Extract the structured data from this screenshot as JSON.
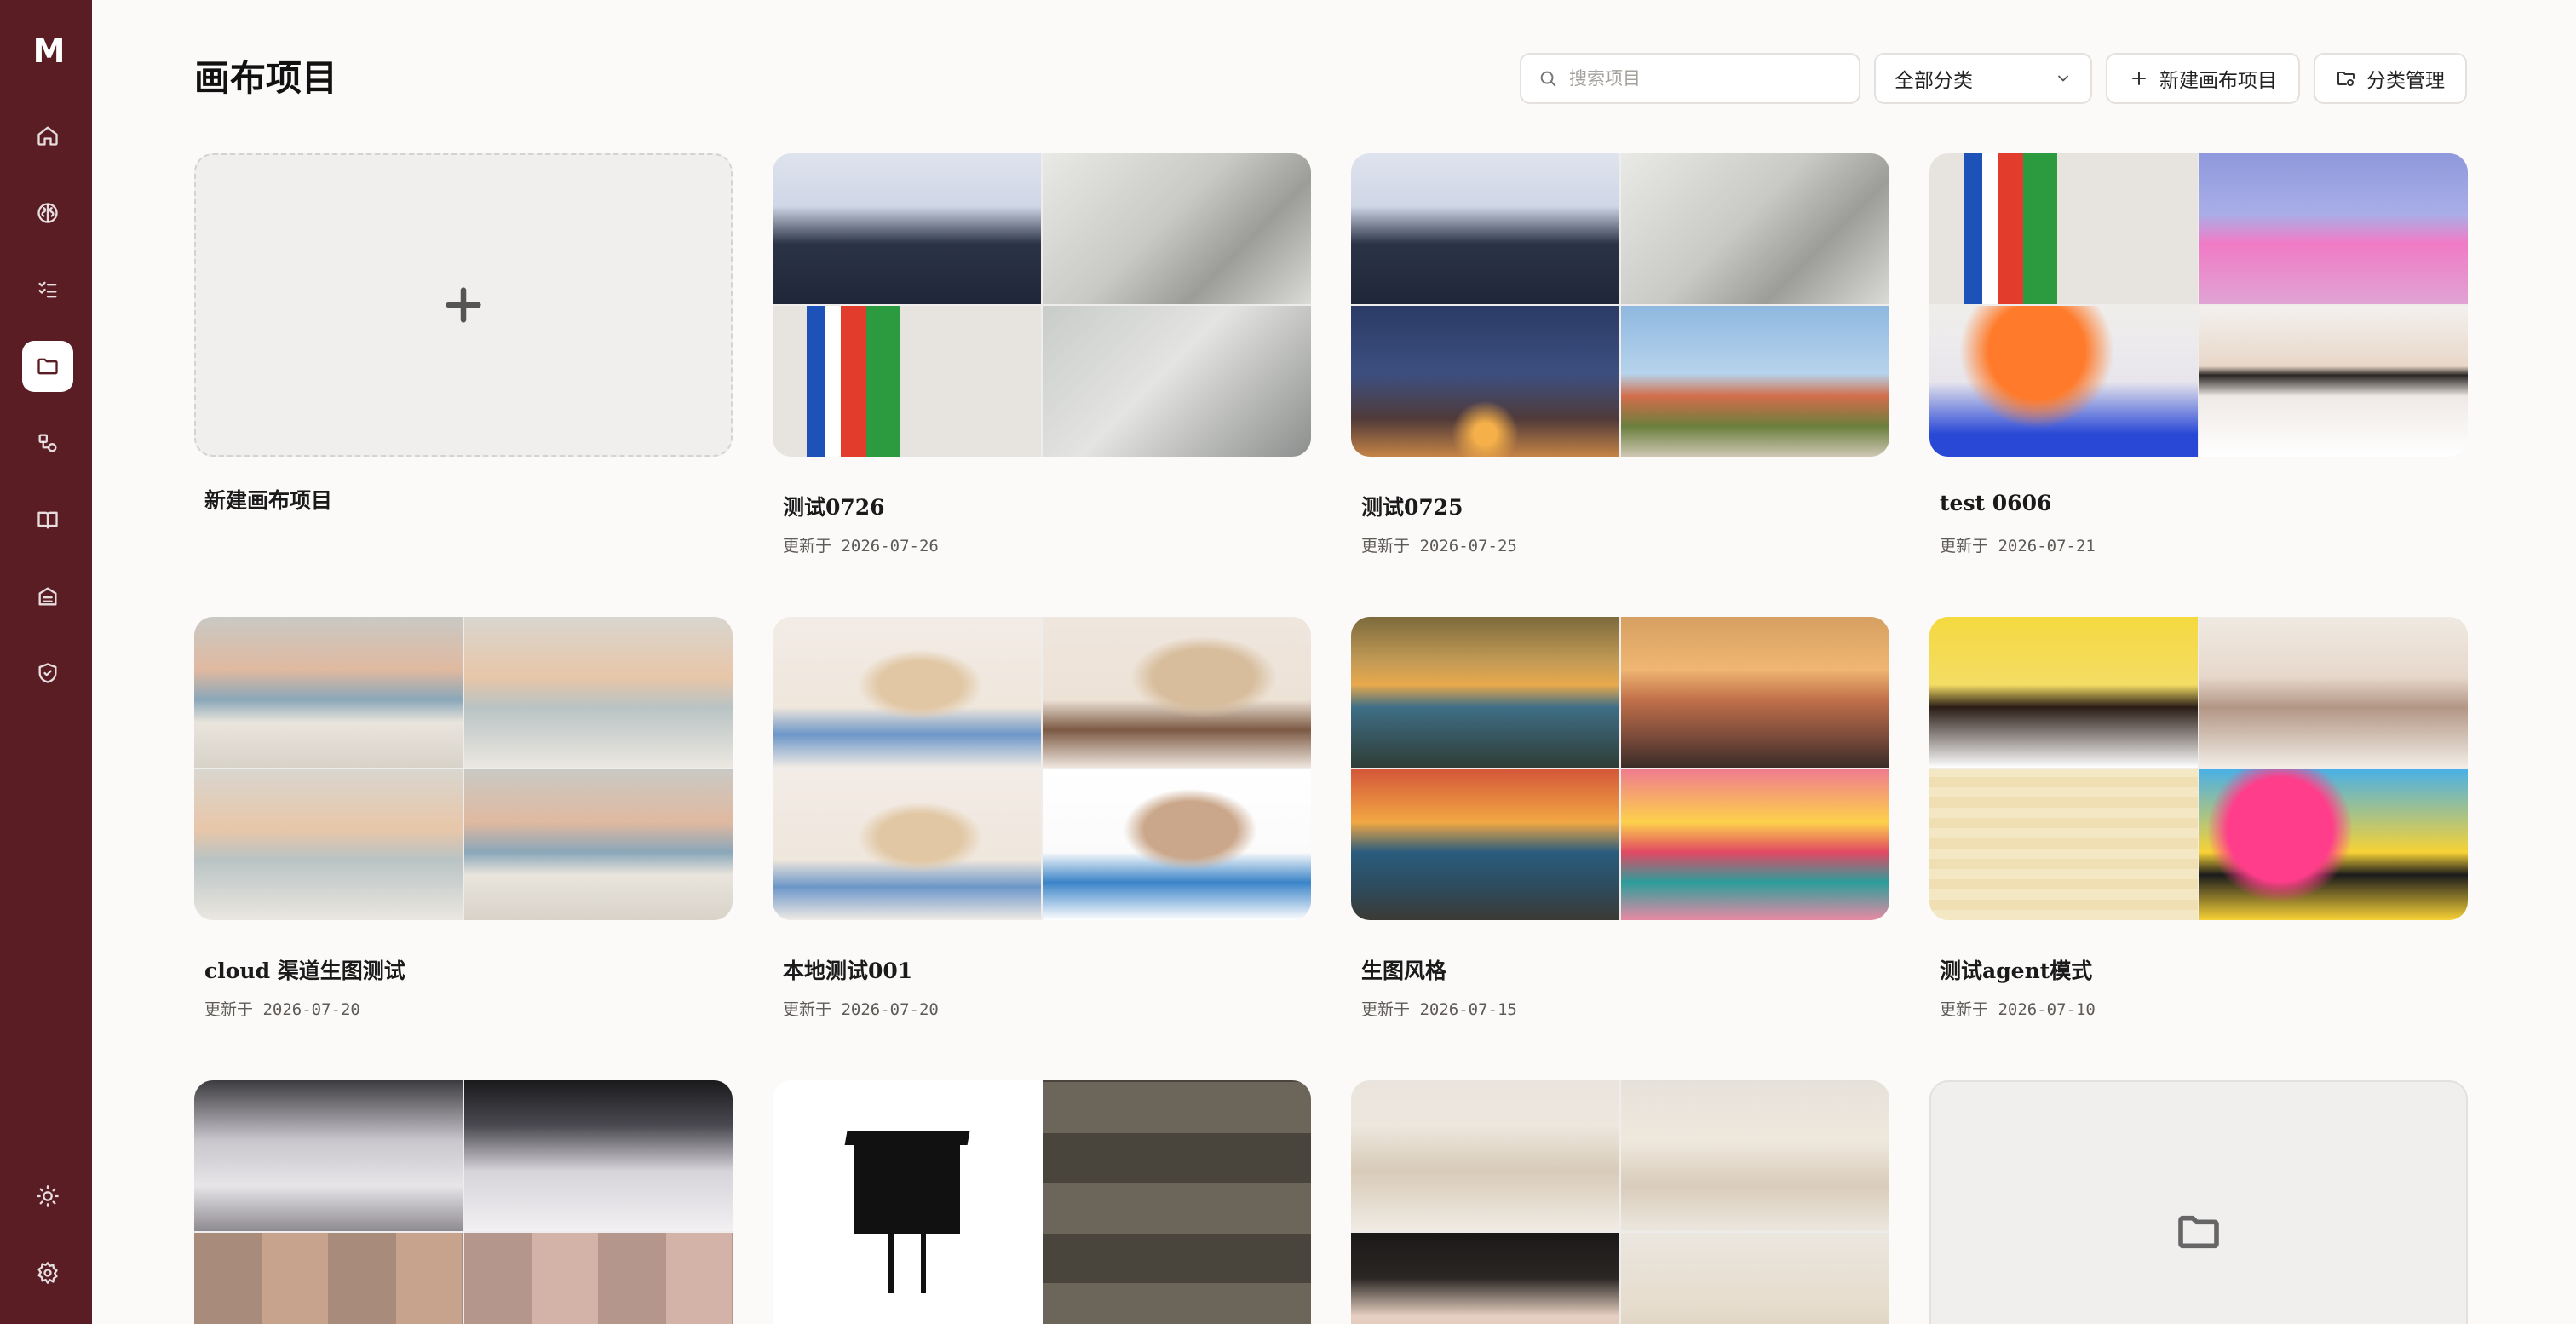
{
  "sidebar": {
    "logo": "M",
    "items": [
      {
        "icon": "home-icon",
        "active": false
      },
      {
        "icon": "brain-icon",
        "active": false
      },
      {
        "icon": "checklist-icon",
        "active": false
      },
      {
        "icon": "folder-icon",
        "active": true
      },
      {
        "icon": "shapes-icon",
        "active": false
      },
      {
        "icon": "book-icon",
        "active": false
      },
      {
        "icon": "archive-icon",
        "active": false
      },
      {
        "icon": "shield-check-icon",
        "active": false
      }
    ],
    "bottom_items": [
      {
        "icon": "sun-icon"
      },
      {
        "icon": "settings-icon"
      }
    ]
  },
  "header": {
    "title": "画布项目",
    "search_placeholder": "搜索项目",
    "category_select": "全部分类",
    "new_button": "新建画布项目",
    "category_button": "分类管理"
  },
  "new_card": {
    "label": "新建画布项目"
  },
  "projects": [
    {
      "title": "测试0726",
      "date": "更新于 2026-07-26"
    },
    {
      "title": "测试0725",
      "date": "更新于 2026-07-25"
    },
    {
      "title": "test 0606",
      "date": "更新于 2026-07-21"
    },
    {
      "title": "cloud 渠道生图测试",
      "date": "更新于 2026-07-20"
    },
    {
      "title": "本地测试001",
      "date": "更新于 2026-07-20"
    },
    {
      "title": "生图风格",
      "date": "更新于 2026-07-15"
    },
    {
      "title": "测试agent模式",
      "date": "更新于 2026-07-10"
    }
  ],
  "colors": {
    "sidebar_bg": "#5a1d24",
    "page_bg": "#fbfaf9",
    "border": "#e3e0dd"
  }
}
